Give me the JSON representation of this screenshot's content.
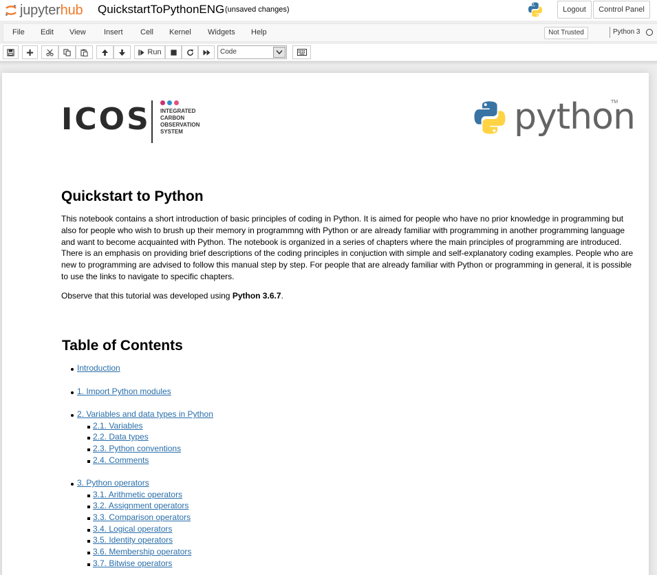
{
  "header": {
    "logo_jupyter": "jupyter",
    "logo_hub": "hub",
    "notebook_name": "QuickstartToPythonENG",
    "save_status": "(unsaved changes)",
    "logout_label": "Logout",
    "control_panel_label": "Control Panel"
  },
  "menubar": {
    "items": [
      "File",
      "Edit",
      "View",
      "Insert",
      "Cell",
      "Kernel",
      "Widgets",
      "Help"
    ],
    "trust_label": "Not Trusted",
    "kernel_name": "Python 3"
  },
  "toolbar": {
    "run_label": "Run",
    "cell_type": "Code",
    "icons": [
      "save-icon",
      "plus-icon",
      "cut-icon",
      "copy-icon",
      "paste-icon",
      "arrow-up-icon",
      "arrow-down-icon",
      "step-forward-icon",
      "stop-icon",
      "refresh-icon",
      "fast-forward-icon",
      "keyboard-icon"
    ]
  },
  "logos": {
    "icos_word": "ICOS",
    "icos_sub": [
      "INTEGRATED",
      "CARBON",
      "OBSERVATION",
      "SYSTEM"
    ],
    "icos_dot_colors": [
      "#c8336e",
      "#2d8fcd",
      "#e0547c"
    ],
    "python_word": "python",
    "python_tm": "TM",
    "python_blue": "#3873a4",
    "python_yellow": "#ffd343"
  },
  "content": {
    "title": "Quickstart to Python",
    "intro": "This notebook contains a short introduction of basic principles of coding in Python. It is aimed for people who have no prior knowledge in programming but also for people who wish to brush up their memory in programmng with Python or are already familiar with programming in another programming language and want to become acquainted with Python. The notebook is organized in a series of chapters where the main principles of programming are introduced. There is an emphasis on providing brief descriptions of the coding principles in conjuction with simple and self-explanatory coding examples. People who are new to programming are advised to follow this manual step by step. For people that are already familiar with Python or programming in general, it is possible to use the links to navigate to specific chapters.",
    "version_prefix": "Observe that this tutorial was developed using ",
    "version_bold": "Python 3.6.7",
    "version_suffix": ".",
    "toc_title": "Table of Contents",
    "toc": {
      "intro": "Introduction",
      "s1": "1. Import Python modules",
      "s2": "2. Variables and data types in Python",
      "s2_1": "2.1. Variables",
      "s2_2": "2.2. Data types",
      "s2_3": "2.3. Python conventions",
      "s2_4": "2.4. Comments",
      "s3": "3. Python operators",
      "s3_1": "3.1. Arithmetic operators",
      "s3_2": "3.2. Assignment operators",
      "s3_3": "3.3. Comparison operators",
      "s3_4": "3.4. Logical operators",
      "s3_5": "3.5. Identity operators",
      "s3_6": "3.6. Membership operators",
      "s3_7": "3.7. Bitwise operators"
    }
  },
  "colors": {
    "link": "#296eaa",
    "hub_orange": "#f37726"
  }
}
